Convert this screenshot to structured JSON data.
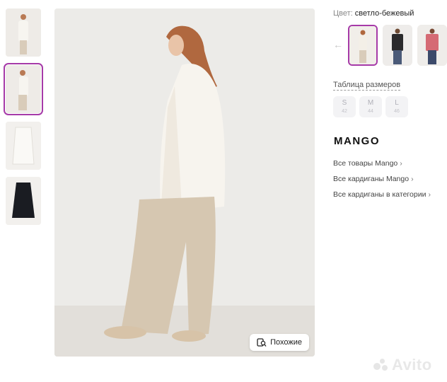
{
  "thumbnails": [
    {
      "name": "cardigan-front-view",
      "active": false
    },
    {
      "name": "cardigan-side-view",
      "active": true
    },
    {
      "name": "cardigan-flat-white",
      "active": false
    },
    {
      "name": "cardigan-flat-black",
      "active": false
    }
  ],
  "main_photo": {
    "similar_button_label": "Похожие"
  },
  "sidebar": {
    "color_label": "Цвет:",
    "color_value": "светло-бежевый",
    "swatches": [
      {
        "name": "light-beige",
        "active": true,
        "colors": {
          "top": "#f3efe7",
          "bottom": "#d9ccba"
        }
      },
      {
        "name": "black",
        "active": false,
        "colors": {
          "top": "#2a2a2c",
          "bottom": "#4a5a78"
        }
      },
      {
        "name": "pink",
        "active": false,
        "colors": {
          "top": "#d56a74",
          "bottom": "#3c4a6a"
        }
      }
    ],
    "size_table_label": "Таблица размеров",
    "sizes": [
      {
        "label": "S",
        "sub": "42"
      },
      {
        "label": "M",
        "sub": "44"
      },
      {
        "label": "L",
        "sub": "46"
      }
    ],
    "brand": "MANGO",
    "links": [
      "Все товары Mango",
      "Все кардиганы Mango",
      "Все кардиганы в категории"
    ]
  },
  "watermark": "Avito",
  "colors": {
    "accent": "#a63aa8",
    "chip_bg": "#f3f3f5",
    "photo_bg": "#ebe9e5"
  }
}
